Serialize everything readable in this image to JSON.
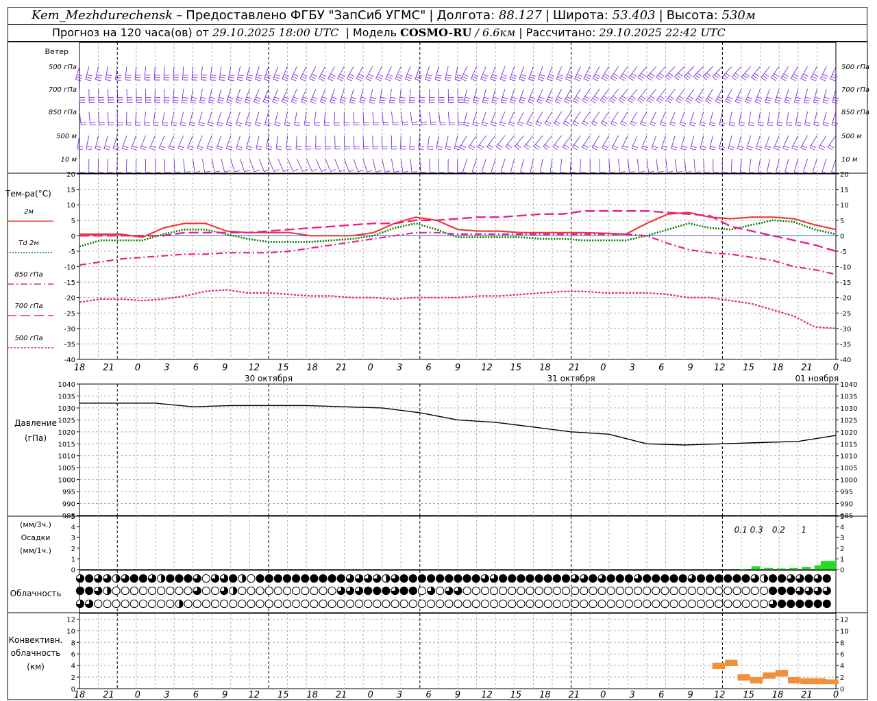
{
  "header": {
    "station": "Kem_Mezhdurechensk",
    "provider": "Предоставлено ФГБУ \"ЗапСиб УГМС\"",
    "lon_label": "Долгота:",
    "lon_value": "88.127",
    "lat_label": "Широта:",
    "lat_value": "53.403",
    "alt_label": "Высота:",
    "alt_value": "530м",
    "forecast_label": "Прогноз на 120 часа(ов) от",
    "forecast_start": "29.10.2025 18:00 UTC",
    "model_label": "Модель",
    "model_name": "COSMO-RU",
    "model_res": "/ 6.6км",
    "calc_label": "Рассчитано:",
    "calc_time": "29.10.2025 22:42 UTC"
  },
  "colors": {
    "wind": "#7a2be2",
    "t2m": "#ee3b30",
    "td2m": "#007800",
    "t_levels": "#e8208a",
    "pressure": "#000000",
    "precip": "#22dd22",
    "conv": "#f0903a",
    "zero_line": "#4060e0",
    "grid": "#b0b0b0"
  },
  "time_axis": {
    "tick_labels": [
      "18",
      "21",
      "0",
      "3",
      "6",
      "9",
      "12",
      "15",
      "18",
      "21",
      "0",
      "3",
      "6",
      "9",
      "12",
      "15",
      "18",
      "21",
      "0",
      "3",
      "6",
      "9",
      "12",
      "15",
      "18",
      "21",
      "0"
    ],
    "day_labels": [
      "30 октября",
      "31 октября",
      "01 ноября"
    ]
  },
  "wind_panel": {
    "title": "Ветер",
    "levels": [
      "500 гПа",
      "700 гПа",
      "850 гПа",
      "500 м",
      "10 м"
    ]
  },
  "chart_data": [
    {
      "type": "line",
      "name": "temperature",
      "ylabel": "Тем-ра(°C)",
      "ylim": [
        -40,
        20
      ],
      "yticks": [
        20,
        15,
        10,
        5,
        0,
        -5,
        -10,
        -15,
        -20,
        -25,
        -30,
        -35,
        -40
      ],
      "x_hours": [
        0,
        3,
        6,
        9,
        12,
        15,
        18,
        21,
        24,
        27,
        30,
        33,
        36,
        39,
        42,
        45,
        48,
        51,
        54,
        57,
        60,
        63,
        66,
        69,
        72,
        75,
        78,
        81,
        84,
        87,
        90,
        93,
        96,
        99,
        102,
        105,
        108,
        111,
        114,
        117,
        120
      ],
      "series": [
        {
          "name": "2м",
          "style": "solid",
          "values": [
            0.5,
            0.5,
            0.5,
            -0.5,
            2.5,
            4,
            4,
            1.5,
            1,
            1,
            1,
            0,
            0,
            0,
            1,
            4,
            6,
            5,
            2,
            1.5,
            1.5,
            1,
            1,
            1,
            1,
            0.8,
            0.5,
            4,
            7,
            7.5,
            6,
            5.5,
            6,
            6,
            5.5,
            3.5,
            2
          ]
        },
        {
          "name": "Td 2м",
          "style": "dotted",
          "values": [
            -3.5,
            -1.5,
            -1.5,
            -1.5,
            0.5,
            2,
            2,
            0.5,
            -1,
            -2,
            -2,
            -2,
            -1.5,
            -1,
            0,
            2.5,
            4,
            2,
            -0.5,
            -0.5,
            -0.5,
            -0.5,
            -1,
            -1,
            -1.5,
            -1.5,
            -1.5,
            0,
            2,
            4,
            2.5,
            2,
            3.5,
            5,
            4.5,
            2,
            0.5
          ]
        },
        {
          "name": "850 гПа",
          "style": "dashdot",
          "values": [
            -9.5,
            -8.5,
            -7.5,
            -7,
            -6.5,
            -6,
            -6,
            -5.5,
            -5.5,
            -5.5,
            -5,
            -4,
            -3,
            -2,
            -1,
            0,
            1,
            1,
            0.5,
            0.5,
            0.5,
            0.5,
            0.5,
            0.5,
            0.5,
            0.5,
            0.5,
            0,
            -2.5,
            -4.5,
            -5.5,
            -6,
            -7,
            -8,
            -10,
            -11,
            -12.5
          ]
        },
        {
          "name": "700 гПа",
          "style": "longdash",
          "values": [
            0,
            0,
            0,
            0,
            0,
            1,
            1,
            1,
            1,
            1.5,
            2,
            2.5,
            3,
            3.5,
            4,
            4,
            5,
            5,
            5.5,
            6,
            6,
            6.5,
            7,
            7,
            8,
            8,
            8,
            8,
            7.5,
            7,
            6.5,
            3,
            1.5,
            0,
            -1.5,
            -3,
            -5
          ]
        },
        {
          "name": "500 гПа",
          "style": "shortdash",
          "values": [
            -21.5,
            -20.5,
            -20.5,
            -21,
            -20.5,
            -19.5,
            -18,
            -17.5,
            -18.5,
            -18.5,
            -19,
            -19.5,
            -19.5,
            -20,
            -20,
            -20.5,
            -20,
            -20,
            -20,
            -19.5,
            -19.5,
            -19,
            -18.5,
            -18,
            -18,
            -18.5,
            -18.5,
            -18.5,
            -19,
            -20,
            -20,
            -21,
            -22,
            -24,
            -26,
            -29.5,
            -30
          ]
        }
      ]
    },
    {
      "type": "line",
      "name": "pressure",
      "ylabel": "Давление",
      "ylabel2": "(гПа)",
      "ylim": [
        985,
        1040
      ],
      "yticks": [
        1040,
        1035,
        1030,
        1025,
        1020,
        1015,
        1010,
        1005,
        1000,
        995,
        990,
        985
      ],
      "x_hours": [
        0,
        6,
        12,
        18,
        24,
        30,
        36,
        42,
        48,
        54,
        60,
        66,
        72,
        78,
        84,
        90,
        96,
        102,
        108,
        114,
        120
      ],
      "values": [
        1032,
        1032,
        1032,
        1030.5,
        1031,
        1031,
        1031,
        1030.5,
        1030,
        1028,
        1025,
        1024,
        1022,
        1020,
        1019,
        1015,
        1014.5,
        1015,
        1015.5,
        1016,
        1018.5
      ]
    },
    {
      "type": "bar",
      "name": "precipitation",
      "ylabel": "(мм/3ч.)",
      "ylabel2": "Осадки",
      "ylabel3": "(мм/1ч.)",
      "ylim": [
        0,
        5
      ],
      "yticks": [
        5,
        4,
        3,
        2,
        1,
        0
      ],
      "annotations": [
        "0.1",
        "0.3",
        "0.2",
        "1"
      ],
      "x_hours": [
        106,
        108,
        110,
        112,
        114,
        116,
        118,
        119,
        120
      ],
      "values": [
        0.05,
        0.3,
        0.15,
        0.1,
        0.15,
        0.25,
        0.4,
        0.8,
        0.8
      ]
    },
    {
      "type": "bar",
      "name": "convective_cloud",
      "ylabel": "Конвективн.",
      "ylabel2": "облачность",
      "ylabel3": "(км)",
      "ylim": [
        0,
        13
      ],
      "yticks": [
        12,
        10,
        8,
        6,
        4,
        2,
        0
      ],
      "x_hours": [
        102,
        104,
        106,
        108,
        110,
        112,
        114,
        116,
        118,
        120
      ],
      "values": [
        4.5,
        5,
        2.5,
        2,
        2.8,
        3.2,
        2,
        1.8,
        1.8,
        1.6
      ]
    }
  ],
  "cloud_panel": {
    "title": "Облачность",
    "rows_octas": [
      [
        6,
        8,
        6,
        6,
        4,
        6,
        8,
        8,
        6,
        4,
        8,
        8,
        8,
        6,
        0,
        6,
        6,
        8,
        4,
        0,
        8,
        8,
        8,
        8,
        8,
        8,
        8,
        8,
        8,
        8,
        6,
        6,
        6,
        6,
        4,
        6,
        8,
        8,
        8,
        8,
        8,
        8,
        8,
        8,
        8,
        6,
        6,
        8,
        8,
        8,
        8,
        8,
        8,
        8,
        8,
        6,
        6,
        8,
        6,
        8,
        8,
        8,
        6,
        8,
        8,
        8,
        8,
        8,
        6,
        8,
        8,
        8,
        8,
        8,
        8,
        6,
        4,
        8,
        8,
        6,
        6,
        8,
        6,
        8
      ],
      [
        8,
        8,
        6,
        4,
        0,
        0,
        0,
        0,
        0,
        0,
        0,
        0,
        0,
        6,
        0,
        0,
        6,
        4,
        0,
        0,
        0,
        0,
        0,
        0,
        0,
        0,
        0,
        0,
        0,
        6,
        6,
        6,
        8,
        8,
        8,
        6,
        8,
        8,
        0,
        6,
        0,
        6,
        6,
        0,
        0,
        0,
        0,
        0,
        0,
        0,
        0,
        0,
        0,
        0,
        0,
        0,
        0,
        0,
        0,
        0,
        0,
        0,
        0,
        0,
        0,
        0,
        0,
        0,
        0,
        0,
        0,
        0,
        0,
        0,
        0,
        0,
        0,
        8,
        8,
        8,
        6,
        6,
        6,
        6
      ],
      [
        6,
        6,
        0,
        0,
        0,
        0,
        0,
        0,
        0,
        0,
        0,
        4,
        0,
        0,
        0,
        0,
        0,
        0,
        0,
        0,
        0,
        0,
        0,
        0,
        0,
        0,
        0,
        0,
        0,
        0,
        0,
        0,
        0,
        0,
        0,
        0,
        0,
        0,
        0,
        0,
        0,
        0,
        0,
        0,
        0,
        0,
        0,
        0,
        0,
        0,
        0,
        0,
        0,
        0,
        0,
        0,
        0,
        0,
        0,
        0,
        0,
        0,
        0,
        0,
        0,
        0,
        0,
        0,
        0,
        0,
        0,
        0,
        0,
        0,
        0,
        0,
        0,
        6,
        8,
        8,
        8,
        8,
        8,
        8
      ]
    ]
  }
}
